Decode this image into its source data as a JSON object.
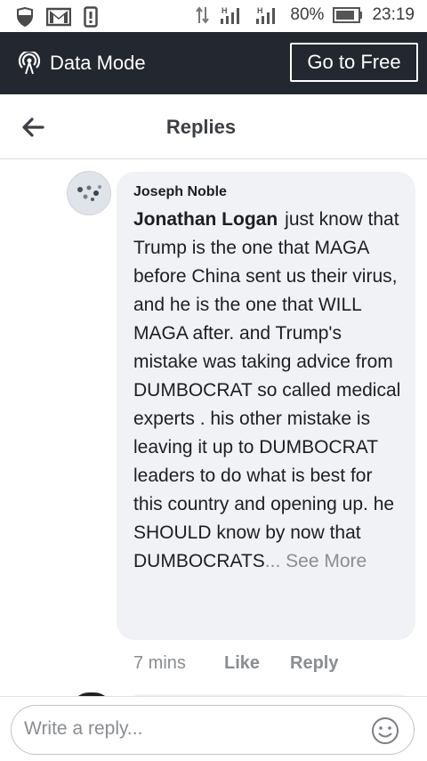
{
  "status_bar": {
    "battery": "80%",
    "time": "23:19",
    "network_type": "H",
    "icons": [
      "shield-icon",
      "gmail-icon",
      "phone-icon",
      "data-arrows-icon",
      "signal-icon",
      "signal-icon",
      "battery-icon"
    ]
  },
  "data_mode": {
    "label": "Data Mode",
    "go_free": "Go to Free"
  },
  "header": {
    "title": "Replies"
  },
  "comment": {
    "author": "Joseph Noble",
    "tag": "Jonathan Logan",
    "text": "just know that Trump is the one that MAGA before China sent us their virus, and he is the one that WILL MAGA after. and Trump's mistake was taking advice from DUMBOCRAT so called medical experts . his other mistake is leaving it up to DUMBOCRAT leaders to do what is best for this country  and opening up.  he SHOULD know by now that DUMBOCRATS",
    "truncation": "...",
    "see_more": "See More",
    "time": "7 mins",
    "like": "Like",
    "reply": "Reply"
  },
  "reply_box": {
    "placeholder": "Write a reply..."
  },
  "colors": {
    "datamode_bg": "#23272f",
    "bubble_bg": "#f0f2f5",
    "muted_text": "#8a8d91"
  }
}
